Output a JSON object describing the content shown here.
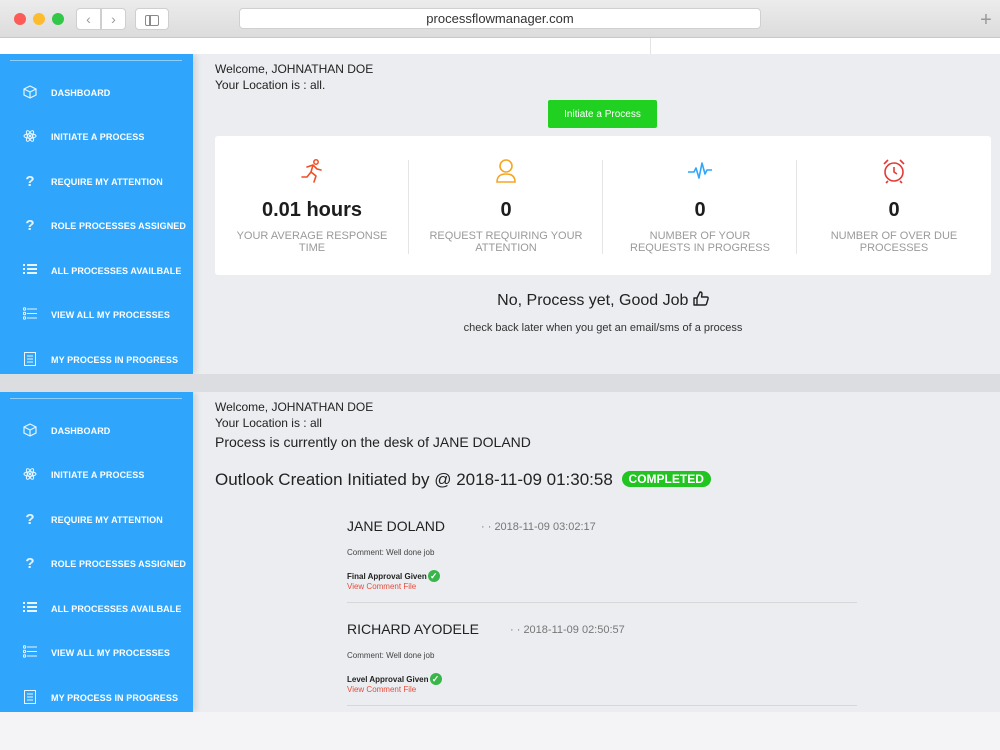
{
  "browser": {
    "url": "processflowmanager.com"
  },
  "sidebar": {
    "items": [
      {
        "label": "DASHBOARD",
        "icon": "cube-icon"
      },
      {
        "label": "INITIATE A PROCESS",
        "icon": "atom-icon"
      },
      {
        "label": "REQUIRE MY ATTENTION",
        "icon": "question-icon"
      },
      {
        "label": "ROLE PROCESSES ASSIGNED",
        "icon": "question-icon"
      },
      {
        "label": "ALL PROCESSES AVAILBALE",
        "icon": "list-icon"
      },
      {
        "label": "VIEW ALL MY PROCESSES",
        "icon": "checklist-icon"
      },
      {
        "label": "MY PROCESS IN PROGRESS",
        "icon": "document-icon"
      }
    ]
  },
  "panel1": {
    "welcome": "Welcome, JOHNATHAN DOE",
    "location": "Your Location is : all.",
    "initiate_button": "Initiate a Process",
    "stats": [
      {
        "value": "0.01 hours",
        "label": "YOUR AVERAGE RESPONSE TIME",
        "icon": "runner-icon",
        "color": "#f04e23"
      },
      {
        "value": "0",
        "label": "REQUEST REQUIRING YOUR ATTENTION",
        "icon": "user-icon",
        "color": "#f5a623"
      },
      {
        "value": "0",
        "label": "NUMBER OF YOUR REQUESTS IN PROGRESS",
        "icon": "pulse-icon",
        "color": "#2fa6fb"
      },
      {
        "value": "0",
        "label": "NUMBER OF OVER DUE PROCESSES",
        "icon": "alarm-clock-icon",
        "color": "#e53935"
      }
    ],
    "empty_title": "No, Process yet, Good Job",
    "empty_subtitle": "check back later when you get an email/sms of a process"
  },
  "panel2": {
    "welcome": "Welcome, JOHNATHAN DOE",
    "location": "Your Location is : all",
    "desk": "Process is currently on the desk of JANE DOLAND",
    "process_title": "Outlook Creation Initiated by @ 2018-11-09 01:30:58",
    "status_badge": "COMPLETED",
    "entries": [
      {
        "name": "JANE DOLAND",
        "time": "· · 2018-11-09 03:02:17",
        "comment": "Comment: Well done job",
        "status": "Final Approval Given",
        "link": "View Comment File"
      },
      {
        "name": "RICHARD AYODELE",
        "time": "· · 2018-11-09 02:50:57",
        "comment": "Comment: Well done job",
        "status": "Level Approval Given",
        "link": "View Comment File"
      }
    ]
  },
  "colors": {
    "sidebar": "#2fa6fb",
    "accent_green": "#21d121",
    "link_red": "#e74c3c"
  }
}
